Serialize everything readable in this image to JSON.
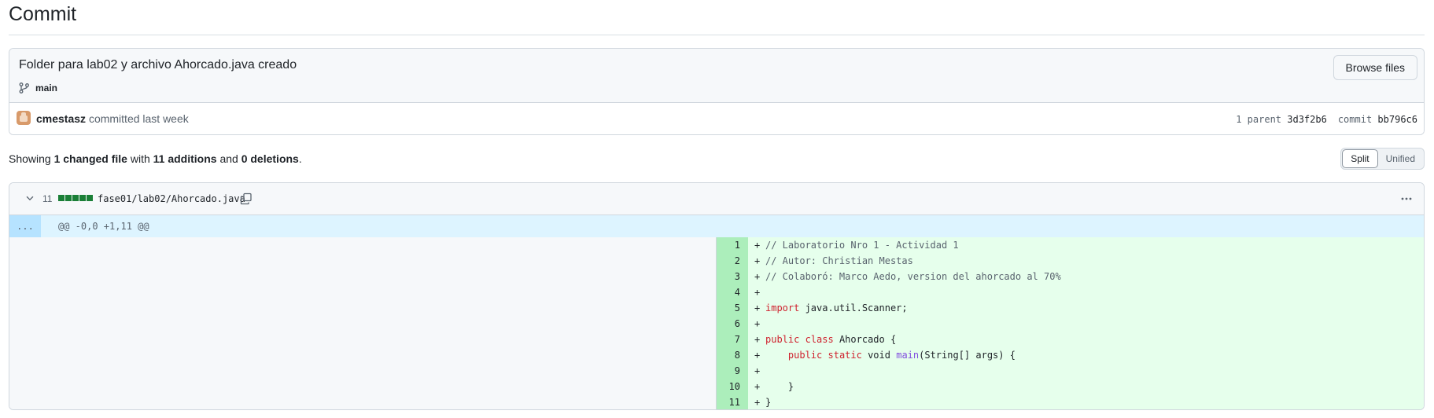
{
  "page": {
    "title": "Commit"
  },
  "commit": {
    "message": "Folder para lab02 y archivo Ahorcado.java creado",
    "branch": "main",
    "browse_label": "Browse files",
    "author": "cmestasz",
    "committed_text": "committed last week",
    "parent_label": "1 parent",
    "parent_sha": "3d3f2b6",
    "commit_label": "commit",
    "commit_sha": "bb796c6"
  },
  "summary": {
    "showing": "Showing",
    "changed": "1 changed file",
    "with": "with",
    "additions": "11 additions",
    "and": "and",
    "deletions": "0 deletions",
    "period": "."
  },
  "view_toggle": {
    "split": "Split",
    "unified": "Unified",
    "selected": "Split"
  },
  "file": {
    "changes": "11",
    "path": "fase01/lab02/Ahorcado.java",
    "hunk_expand": "...",
    "hunk_header": "@@ -0,0 +1,11 @@",
    "lines": [
      {
        "num": "1",
        "code": "// Laboratorio Nro 1 - Actividad 1"
      },
      {
        "num": "2",
        "code": "// Autor: Christian Mestas"
      },
      {
        "num": "3",
        "code": "// Colaboró: Marco Aedo, version del ahorcado al 70%"
      },
      {
        "num": "4",
        "code": ""
      },
      {
        "num": "5",
        "code": "import java.util.Scanner;"
      },
      {
        "num": "6",
        "code": ""
      },
      {
        "num": "7",
        "code": "public class Ahorcado {"
      },
      {
        "num": "8",
        "code": "    public static void main(String[] args) {"
      },
      {
        "num": "9",
        "code": ""
      },
      {
        "num": "10",
        "code": "    }"
      },
      {
        "num": "11",
        "code": "}"
      }
    ]
  },
  "colors": {
    "addition_bg": "#e6ffec",
    "addition_num_bg": "#aceebb",
    "hunk_bg": "#ddf4ff",
    "stat_block": "#1a7f37"
  },
  "icons": [
    "git-branch-icon",
    "chevron-down-icon",
    "copy-icon",
    "kebab-horizontal-icon",
    "avatar"
  ]
}
